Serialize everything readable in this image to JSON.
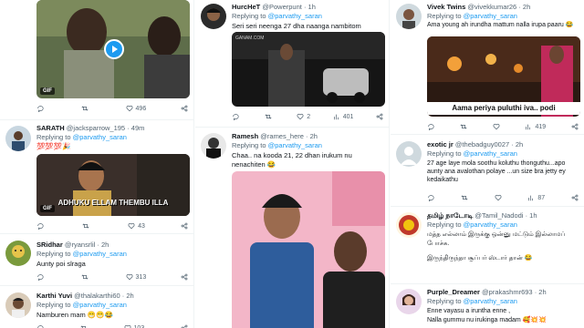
{
  "col1": {
    "t1": {
      "stats": {
        "reply": "",
        "retweet": "",
        "like": "496",
        "view": ""
      }
    },
    "t2": {
      "name": "SARATH",
      "handle": "@jacksparrow_195",
      "time": "· 49m",
      "replying": "Replying to",
      "mention": "@parvathy_saran",
      "text": "💯💯💯🎉",
      "gif_label": "GIF",
      "caption": "ADHUKU ELLAM THEMBU ILLA",
      "stats": {
        "reply": "",
        "retweet": "",
        "like": "43",
        "view": ""
      }
    },
    "t3": {
      "name": "SRidhar",
      "handle": "@ryansrlil",
      "time": "· 2h",
      "replying": "Replying to",
      "mention": "@parvathy_saran",
      "text": "Aunty poi slraga",
      "stats": {
        "reply": "",
        "retweet": "",
        "like": "313",
        "view": ""
      }
    },
    "t4": {
      "name": "Karthi Yuvi",
      "handle": "@thalakarthi60",
      "time": "· 2h",
      "replying": "Replying to",
      "mention": "@parvathy_saran",
      "text": "Namburen mam 😁😁😂",
      "stats": {
        "like": "103"
      }
    }
  },
  "col2": {
    "t1": {
      "name": "HurcHeT",
      "handle": "@Powerpunt",
      "time": "· 1h",
      "replying": "Replying to",
      "mention": "@parvathy_saran",
      "text": "Seri seri neenga 27 dha naanga nambitom",
      "watermark": "GANAM.COM",
      "stats": {
        "reply": "",
        "retweet": "",
        "like": "2",
        "view": "401"
      }
    },
    "t2": {
      "name": "Ramesh",
      "handle": "@rames_here",
      "time": "· 2h",
      "replying": "Replying to",
      "mention": "@parvathy_saran",
      "text": "Chaa.. na kooda 21, 22 dhan irukum nu nenachiten 😂"
    }
  },
  "col3": {
    "t1": {
      "name": "Vivek Twins",
      "handle": "@vivekkumar26",
      "time": "· 2h",
      "replying": "Replying to",
      "mention": "@parvathy_saran",
      "text": "Ama young ah irundha mattum nalla irupa paaru 😂",
      "caption": "Aama periya puluthi iva.. podi",
      "stats": {
        "reply": "",
        "retweet": "",
        "like": "",
        "view": "419"
      }
    },
    "t2": {
      "name": "exotic jr",
      "handle": "@thebadguy0027",
      "time": "· 2h",
      "replying": "Replying to",
      "mention": "@parvathy_saran",
      "text": "27 age laye mola soothu koluthu thonguthu...apo aunty ana avalothan polaye ...un size bra jetty ey kedaikathu",
      "stats": {
        "reply": "",
        "retweet": "",
        "like": "",
        "view": "87"
      }
    },
    "t3": {
      "name": "தமிழ் நாடோடி",
      "handle": "@Tamil_Nadodi",
      "time": "· 1h",
      "replying": "Replying to",
      "mention": "@parvathy_saran",
      "text1": "மத்த எல்லாம் இருக்கு ஒன்னு மட்டும் இல்லாமப் போச்சு.",
      "text2": "இருந்திருந்தா சூப்பர் ஸ்டார் தான் 😂"
    },
    "t4": {
      "name": "Purple_Dreamer",
      "handle": "@prakashmr693",
      "time": "· 2h",
      "replying": "Replying to",
      "mention": "@parvathy_saran",
      "text1": "Enne vayasu a iruntha enne ,",
      "text2": "Nalla gummu nu irukinga madam 🥰💥💥"
    }
  }
}
